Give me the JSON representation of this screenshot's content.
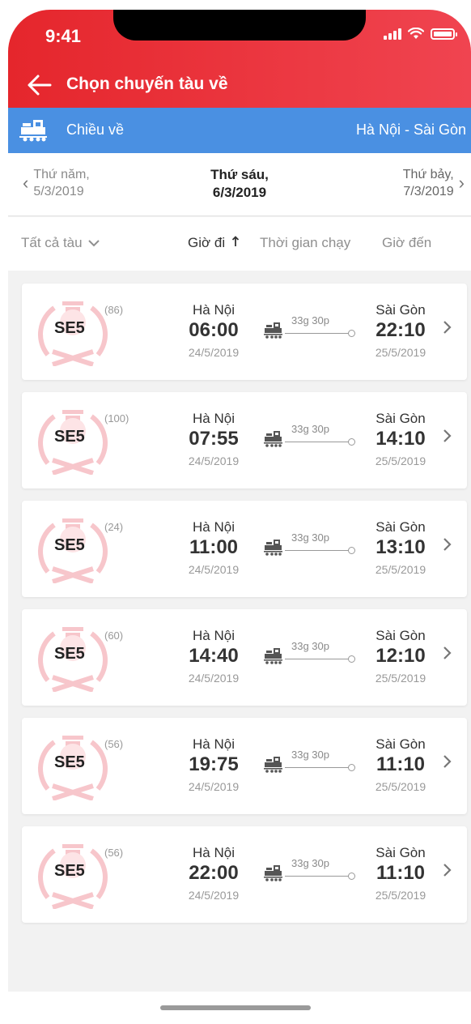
{
  "status_bar": {
    "time": "9:41"
  },
  "header": {
    "title": "Chọn chuyến tàu về"
  },
  "direction": {
    "label": "Chiều về",
    "route": "Hà Nội - Sài Gòn"
  },
  "dates": {
    "prev": {
      "day": "Thứ năm,",
      "date": "5/3/2019"
    },
    "current": {
      "day": "Thứ sáu,",
      "date": "6/3/2019"
    },
    "next": {
      "day": "Thứ bảy,",
      "date": "7/3/2019"
    }
  },
  "sort": {
    "all_trains": "Tất cả tàu",
    "departure": "Giờ đi",
    "duration": "Thời gian chạy",
    "arrival": "Giờ đến"
  },
  "colors": {
    "header_red": "#e5262c",
    "direction_blue": "#4a90e2",
    "emblem_pink": "#f7c6cb"
  },
  "trips": [
    {
      "train": "SE5",
      "seats": "(86)",
      "from": "Hà Nội",
      "dep_time": "06:00",
      "dep_date": "24/5/2019",
      "duration": "33g 30p",
      "to": "Sài Gòn",
      "arr_time": "22:10",
      "arr_date": "25/5/2019"
    },
    {
      "train": "SE5",
      "seats": "(100)",
      "from": "Hà Nội",
      "dep_time": "07:55",
      "dep_date": "24/5/2019",
      "duration": "33g 30p",
      "to": "Sài Gòn",
      "arr_time": "14:10",
      "arr_date": "25/5/2019"
    },
    {
      "train": "SE5",
      "seats": "(24)",
      "from": "Hà Nội",
      "dep_time": "11:00",
      "dep_date": "24/5/2019",
      "duration": "33g 30p",
      "to": "Sài Gòn",
      "arr_time": "13:10",
      "arr_date": "25/5/2019"
    },
    {
      "train": "SE5",
      "seats": "(60)",
      "from": "Hà Nội",
      "dep_time": "14:40",
      "dep_date": "24/5/2019",
      "duration": "33g 30p",
      "to": "Sài Gòn",
      "arr_time": "12:10",
      "arr_date": "25/5/2019"
    },
    {
      "train": "SE5",
      "seats": "(56)",
      "from": "Hà Nội",
      "dep_time": "19:75",
      "dep_date": "24/5/2019",
      "duration": "33g 30p",
      "to": "Sài Gòn",
      "arr_time": "11:10",
      "arr_date": "25/5/2019"
    },
    {
      "train": "SE5",
      "seats": "(56)",
      "from": "Hà Nội",
      "dep_time": "22:00",
      "dep_date": "24/5/2019",
      "duration": "33g 30p",
      "to": "Sài Gòn",
      "arr_time": "11:10",
      "arr_date": "25/5/2019"
    }
  ]
}
